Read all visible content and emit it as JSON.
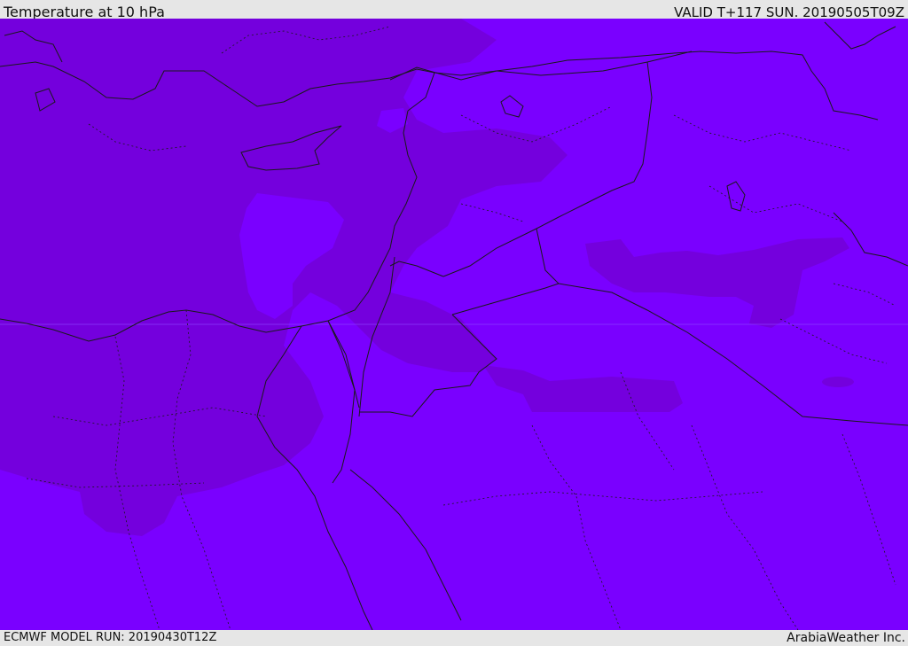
{
  "header": {
    "title": "Temperature at 10 hPa",
    "valid": "VALID T+117 SUN. 20190505T09Z"
  },
  "footer": {
    "model_run": "ECMWF MODEL RUN: 20190430T12Z",
    "credit": "ArabiaWeather Inc."
  },
  "colors": {
    "field_warm": "#7a00ff",
    "field_cool": "#7400dd",
    "coast": "#1a1a1a"
  }
}
